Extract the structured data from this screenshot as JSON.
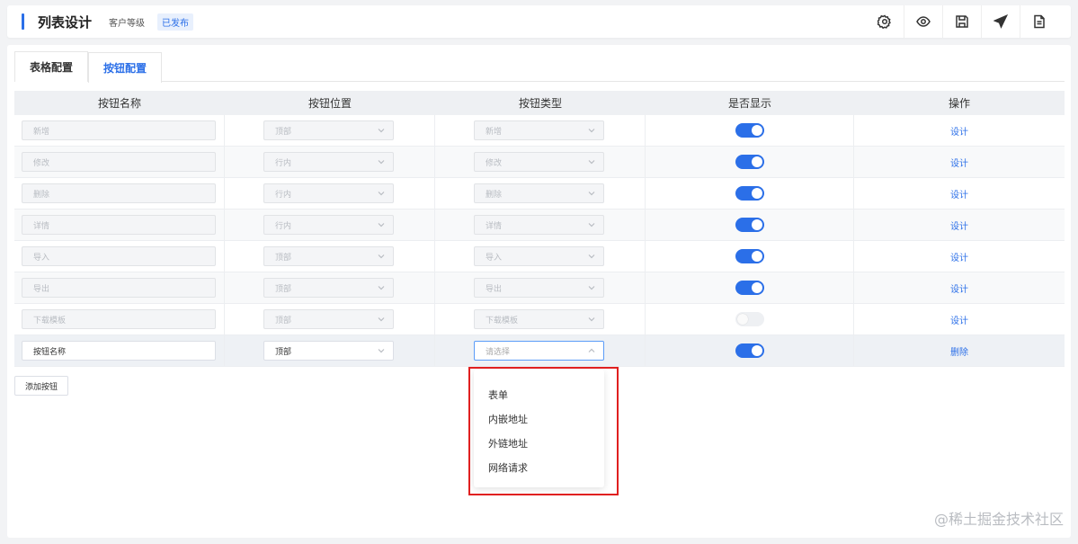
{
  "header": {
    "title": "列表设计",
    "subtitle": "客户等级",
    "badge": "已发布",
    "icons": [
      "settings-icon",
      "eye-icon",
      "save-icon",
      "send-icon",
      "document-icon"
    ]
  },
  "tabs": [
    {
      "label": "表格配置"
    },
    {
      "label": "按钮配置"
    }
  ],
  "table": {
    "columns": [
      "按钮名称",
      "按钮位置",
      "按钮类型",
      "是否显示",
      "操作"
    ],
    "rows": [
      {
        "name": "新增",
        "position": "顶部",
        "type": "新增",
        "visible": true,
        "action": "设计"
      },
      {
        "name": "修改",
        "position": "行内",
        "type": "修改",
        "visible": true,
        "action": "设计"
      },
      {
        "name": "删除",
        "position": "行内",
        "type": "删除",
        "visible": true,
        "action": "设计"
      },
      {
        "name": "详情",
        "position": "行内",
        "type": "详情",
        "visible": true,
        "action": "设计"
      },
      {
        "name": "导入",
        "position": "顶部",
        "type": "导入",
        "visible": true,
        "action": "设计"
      },
      {
        "name": "导出",
        "position": "顶部",
        "type": "导出",
        "visible": true,
        "action": "设计"
      },
      {
        "name": "下载模板",
        "position": "顶部",
        "type": "下载模板",
        "visible": false,
        "action": "设计"
      },
      {
        "name": "按钮名称",
        "position": "顶部",
        "type_placeholder": "请选择",
        "visible": true,
        "action": "删除"
      }
    ]
  },
  "add_button": "添加按钮",
  "dropdown": {
    "options": [
      "表单",
      "内嵌地址",
      "外链地址",
      "网络请求"
    ]
  },
  "watermark": "@稀土掘金技术社区",
  "colors": {
    "accent": "#2b6fe8",
    "highlight": "#e02020"
  }
}
